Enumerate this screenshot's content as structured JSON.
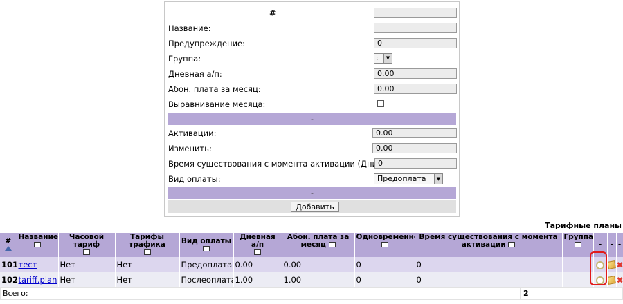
{
  "form": {
    "header": "#",
    "fields": [
      {
        "label": "Название:",
        "value": ""
      },
      {
        "label": "Предупреждение:",
        "value": "0"
      },
      {
        "label": "Группа:",
        "value": ":"
      },
      {
        "label": "Дневная а/п:",
        "value": "0.00"
      },
      {
        "label": "Абон. плата за месяц:",
        "value": "0.00"
      },
      {
        "label": "Выравнивание месяца:",
        "value": ""
      }
    ],
    "section_bar_1": "-",
    "fields2": [
      {
        "label": "Активации:",
        "value": "0.00"
      },
      {
        "label": "Изменить:",
        "value": "0.00"
      },
      {
        "label": "Время существования с момента активации (Дни):",
        "value": "0"
      },
      {
        "label": "Вид оплаты:",
        "value": "Предоплата"
      }
    ],
    "section_bar_2": "-",
    "add_label": "Добавить"
  },
  "table": {
    "caption": "Тарифные планы",
    "columns": [
      "#",
      "Название",
      "Часовой тариф",
      "Тарифы трафика",
      "Вид оплаты",
      "Дневная а/п",
      "Абон. плата за месяц",
      "Одновременно",
      "Время существования с момента активации",
      "Группа",
      "-",
      "-",
      "-"
    ],
    "rows": [
      {
        "id": "101",
        "name": "тест",
        "hourly": "Нет",
        "traffic": "Нет",
        "payment": "Предоплата",
        "daily": "0.00",
        "monthly": "0.00",
        "simultaneous": "0",
        "lifetime": "0",
        "group": ""
      },
      {
        "id": "102",
        "name": "tariff.plan",
        "hourly": "Нет",
        "traffic": "Нет",
        "payment": "Послеоплата",
        "daily": "1.00",
        "monthly": "1.00",
        "simultaneous": "0",
        "lifetime": "0",
        "group": ""
      }
    ],
    "total_label": "Всего:",
    "total_value": "2"
  },
  "colors": {
    "header_purple": "#b5a7d6",
    "row_purple": "#dcd6ee",
    "highlight_red": "#e21a1a"
  },
  "icons": [
    "clock-icon",
    "edit-icon",
    "delete-icon",
    "sort-asc-icon"
  ]
}
